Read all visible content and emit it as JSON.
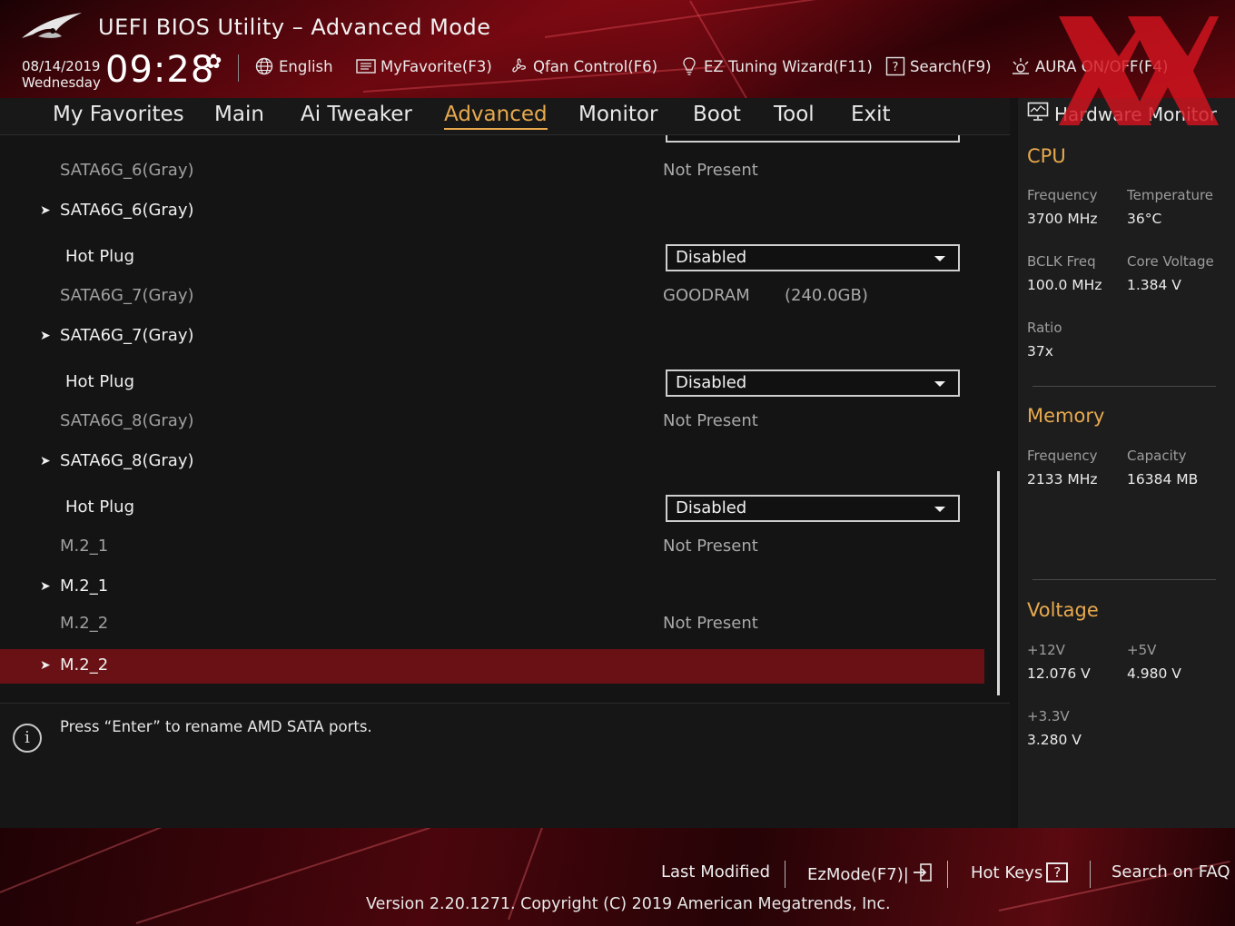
{
  "header": {
    "title": "UEFI BIOS Utility – Advanced Mode",
    "date": "08/14/2019",
    "day": "Wednesday",
    "time": "09:28",
    "toolbar": [
      {
        "label": "English",
        "icon": "globe-icon"
      },
      {
        "label": "MyFavorite(F3)",
        "icon": "favorites-list-icon"
      },
      {
        "label": "Qfan Control(F6)",
        "icon": "fan-icon"
      },
      {
        "label": "EZ Tuning Wizard(F11)",
        "icon": "lightbulb-icon"
      },
      {
        "label": "Search(F9)",
        "icon": "question-box-icon"
      },
      {
        "label": "AURA ON/OFF(F4)",
        "icon": "aura-light-icon"
      }
    ]
  },
  "nav": {
    "tabs": [
      "My Favorites",
      "Main",
      "Ai Tweaker",
      "Advanced",
      "Monitor",
      "Boot",
      "Tool",
      "Exit"
    ],
    "active": "Advanced"
  },
  "main": {
    "rows": {
      "r0": {
        "label": "SATA6G_6(Gray)",
        "value": "Not Present"
      },
      "r1": {
        "label": "SATA6G_6(Gray)"
      },
      "r2": {
        "label": "Hot Plug",
        "value": "Disabled"
      },
      "r3": {
        "label": "SATA6G_7(Gray)",
        "value": "GOODRAM",
        "value2": "(240.0GB)"
      },
      "r4": {
        "label": "SATA6G_7(Gray)"
      },
      "r5": {
        "label": "Hot Plug",
        "value": "Disabled"
      },
      "r6": {
        "label": "SATA6G_8(Gray)",
        "value": "Not Present"
      },
      "r7": {
        "label": "SATA6G_8(Gray)"
      },
      "r8": {
        "label": "Hot Plug",
        "value": "Disabled"
      },
      "r9": {
        "label": "M.2_1",
        "value": "Not Present"
      },
      "r10": {
        "label": "M.2_1"
      },
      "r11": {
        "label": "M.2_2",
        "value": "Not Present"
      },
      "r12": {
        "label": "M.2_2"
      }
    }
  },
  "help": {
    "message": "Press “Enter” to rename AMD SATA ports."
  },
  "hardware_monitor": {
    "title": "Hardware Monitor",
    "cpu": {
      "title": "CPU",
      "frequency_label": "Frequency",
      "frequency": "3700 MHz",
      "temperature_label": "Temperature",
      "temperature": "36°C",
      "bclk_label": "BCLK Freq",
      "bclk": "100.0 MHz",
      "core_voltage_label": "Core Voltage",
      "core_voltage": "1.384 V",
      "ratio_label": "Ratio",
      "ratio": "37x"
    },
    "memory": {
      "title": "Memory",
      "frequency_label": "Frequency",
      "frequency": "2133 MHz",
      "capacity_label": "Capacity",
      "capacity": "16384 MB"
    },
    "voltage": {
      "title": "Voltage",
      "v12_label": "+12V",
      "v12": "12.076 V",
      "v5_label": "+5V",
      "v5": "4.980 V",
      "v33_label": "+3.3V",
      "v33": "3.280 V"
    }
  },
  "footer": {
    "last_modified": "Last Modified",
    "ezmode": "EzMode(F7)|",
    "hot_keys": "Hot Keys",
    "search_faq": "Search on FAQ",
    "version": "Version 2.20.1271. Copyright (C) 2019 American Megatrends, Inc."
  },
  "colors": {
    "accent": "#e8a94e",
    "selected_row": "#6a1115",
    "header_red": "#6b0a12"
  }
}
